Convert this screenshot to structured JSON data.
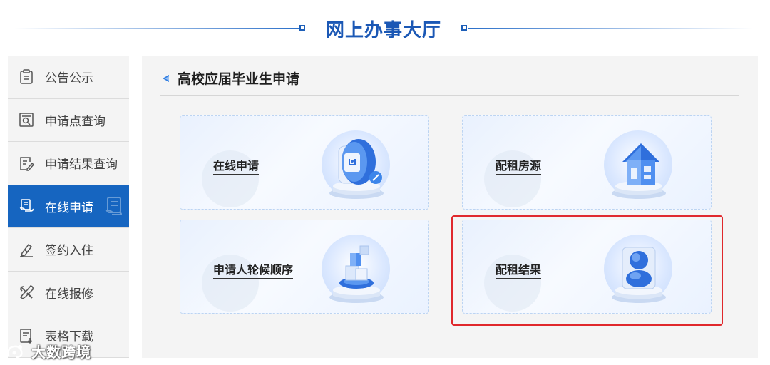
{
  "header": {
    "title": "网上办事大厅"
  },
  "sidebar": {
    "items": [
      {
        "label": "公告公示",
        "icon": "notice-clipboard-icon"
      },
      {
        "label": "申请点查询",
        "icon": "search-document-icon"
      },
      {
        "label": "申请结果查询",
        "icon": "edit-document-icon"
      },
      {
        "label": "在线申请",
        "icon": "hand-document-icon",
        "active": true
      },
      {
        "label": "签约入住",
        "icon": "signature-pen-icon"
      },
      {
        "label": "在线报修",
        "icon": "repair-tools-icon"
      },
      {
        "label": "表格下载",
        "icon": "download-form-icon"
      }
    ]
  },
  "section": {
    "title": "高校应届毕业生申请",
    "cards": [
      {
        "label": "在线申请",
        "icon": "online-application-icon"
      },
      {
        "label": "配租房源",
        "icon": "house-icon"
      },
      {
        "label": "申请人轮候顺序",
        "icon": "queue-blocks-icon"
      },
      {
        "label": "配租结果",
        "icon": "result-person-icon"
      }
    ]
  },
  "watermark": {
    "text": "大数跨境"
  },
  "colors": {
    "accent": "#1665c0",
    "title": "#1b58b5",
    "highlight": "#e0282c"
  }
}
